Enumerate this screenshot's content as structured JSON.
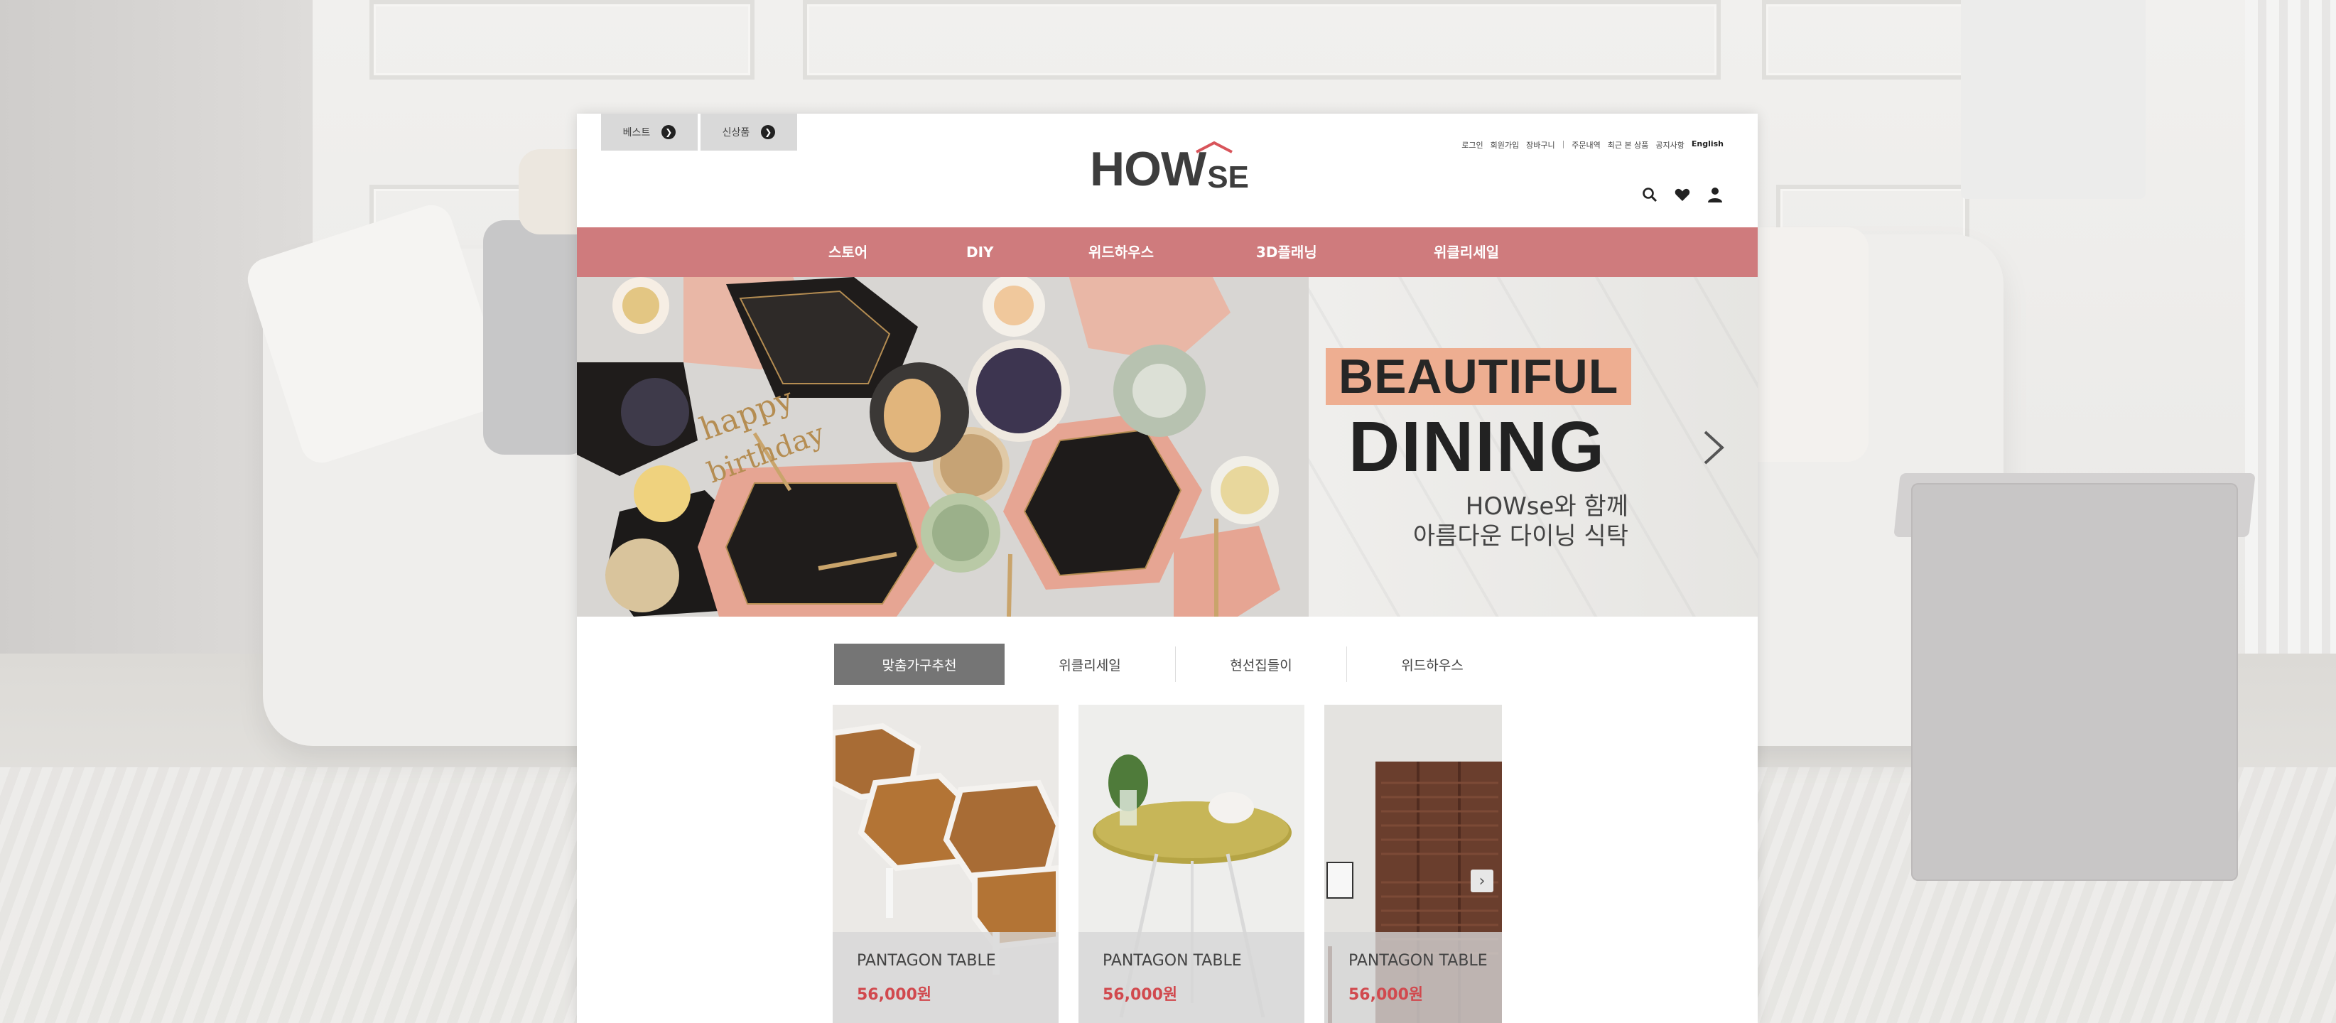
{
  "top_pills": [
    {
      "label": "베스트"
    },
    {
      "label": "신상품"
    }
  ],
  "logo": {
    "main": "HOW",
    "suffix": "SE"
  },
  "util_nav": {
    "items": [
      "로그인",
      "회원가입",
      "장바구니",
      "주문내역",
      "최근 본 상품",
      "공지사항"
    ],
    "language": "English"
  },
  "main_nav": [
    "스토어",
    "DIY",
    "위드하우스",
    "3D플래닝",
    "위클리세일"
  ],
  "hero": {
    "headline_1": "BEAUTIFUL",
    "headline_2": "DINING",
    "sub_1": "HOWse와 함께",
    "sub_2": "아름다운 다이닝 식탁"
  },
  "tabs": [
    {
      "label": "맞춤가구추천",
      "active": true
    },
    {
      "label": "위클리세일",
      "active": false
    },
    {
      "label": "현선집들이",
      "active": false
    },
    {
      "label": "위드하우스",
      "active": false
    }
  ],
  "products": [
    {
      "name": "PANTAGON TABLE",
      "price": "56,000원"
    },
    {
      "name": "PANTAGON TABLE",
      "price": "56,000원"
    },
    {
      "name": "PANTAGON TABLE",
      "price": "56,000원"
    }
  ],
  "colors": {
    "nav_bg": "#cf7b7d",
    "accent_price": "#d1494e",
    "beautiful_bg": "#eeae91",
    "active_tab": "#757575"
  },
  "icons": [
    "search-icon",
    "heart-icon",
    "user-icon",
    "chevron-right-icon"
  ]
}
